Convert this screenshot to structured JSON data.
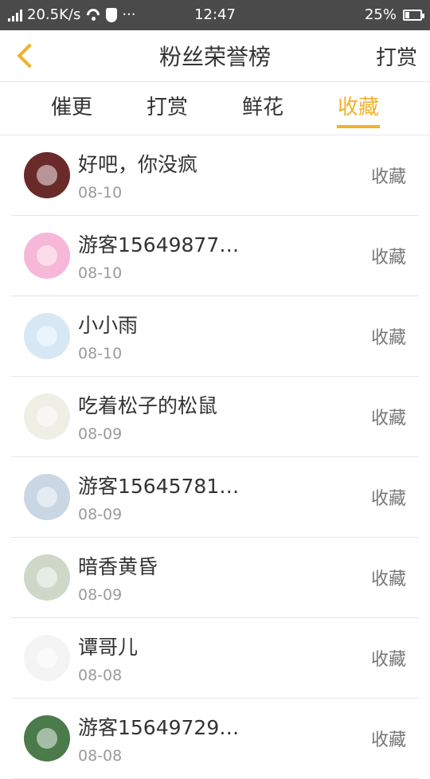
{
  "statusbar": {
    "speed": "20.5K/s",
    "dots": "···",
    "time": "12:47",
    "battery": "25%",
    "battery_level": 0.25
  },
  "header": {
    "title": "粉丝荣誉榜",
    "action": "打赏"
  },
  "tabs": [
    {
      "label": "催更",
      "active": false
    },
    {
      "label": "打赏",
      "active": false
    },
    {
      "label": "鲜花",
      "active": false
    },
    {
      "label": "收藏",
      "active": true
    }
  ],
  "items": [
    {
      "name": "好吧，你没疯",
      "date": "08-10",
      "tag": "收藏",
      "avatar_color": "#6b2a2a"
    },
    {
      "name": "游客15649877…",
      "date": "08-10",
      "tag": "收藏",
      "avatar_color": "#f6b8d6"
    },
    {
      "name": "小小雨",
      "date": "08-10",
      "tag": "收藏",
      "avatar_color": "#d6e8f6"
    },
    {
      "name": "吃着松子的松鼠",
      "date": "08-09",
      "tag": "收藏",
      "avatar_color": "#efefe6"
    },
    {
      "name": "游客15645781…",
      "date": "08-09",
      "tag": "收藏",
      "avatar_color": "#c9d6e3"
    },
    {
      "name": "暗香黄昏",
      "date": "08-09",
      "tag": "收藏",
      "avatar_color": "#cfd8c8"
    },
    {
      "name": "谭哥儿",
      "date": "08-08",
      "tag": "收藏",
      "avatar_color": "#f4f4f4"
    },
    {
      "name": "游客15649729…",
      "date": "08-08",
      "tag": "收藏",
      "avatar_color": "#4b7a4b"
    }
  ]
}
